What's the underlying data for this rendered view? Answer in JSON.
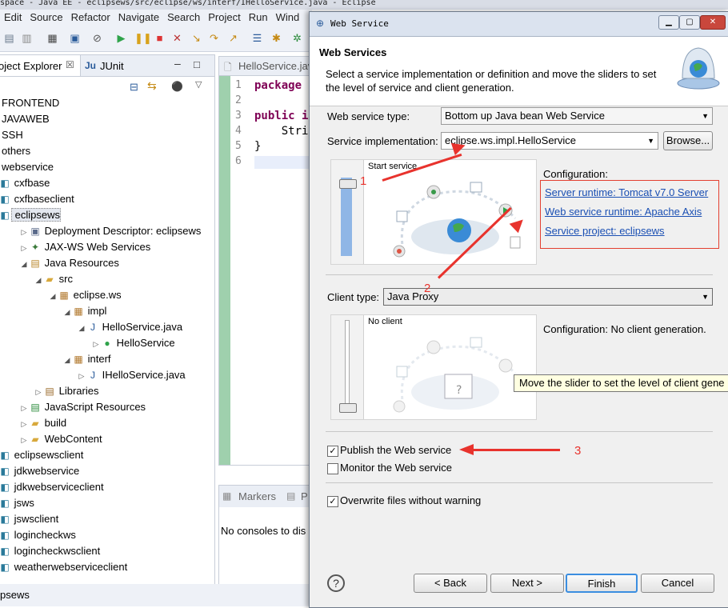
{
  "eclipse": {
    "title": "space - Java EE - eclipsews/src/eclipse/ws/interf/IHelloService.java - Eclipse",
    "menu": [
      "Edit",
      "Source",
      "Refactor",
      "Navigate",
      "Search",
      "Project",
      "Run",
      "Wind"
    ],
    "panels": {
      "project_explorer": "oject Explorer",
      "junit": "JUnit"
    },
    "editor": {
      "tab": "HelloService.java",
      "lines": [
        {
          "n": "1",
          "code": "package"
        },
        {
          "n": "2",
          "code": ""
        },
        {
          "n": "3",
          "code": "public i"
        },
        {
          "n": "4",
          "code": "    Stri"
        },
        {
          "n": "5",
          "code": "}"
        },
        {
          "n": "6",
          "code": ""
        }
      ]
    },
    "console": {
      "tab_markers": "Markers",
      "tab_p": "P",
      "message": "No consoles to dis"
    },
    "status": "psews",
    "tree": [
      {
        "label": "FRONTEND",
        "depth": 0,
        "icon": "none",
        "twisty": ""
      },
      {
        "label": "JAVAWEB",
        "depth": 0,
        "icon": "none",
        "twisty": ""
      },
      {
        "label": "SSH",
        "depth": 0,
        "icon": "none",
        "twisty": ""
      },
      {
        "label": "others",
        "depth": 0,
        "icon": "none",
        "twisty": ""
      },
      {
        "label": "webservice",
        "depth": 0,
        "icon": "none",
        "twisty": ""
      },
      {
        "label": "cxfbase",
        "depth": 0,
        "icon": "project",
        "twisty": ""
      },
      {
        "label": "cxfbaseclient",
        "depth": 0,
        "icon": "project",
        "twisty": ""
      },
      {
        "label": "eclipsews",
        "depth": 0,
        "icon": "project",
        "twisty": "",
        "selected": true
      },
      {
        "label": "Deployment Descriptor: eclipsews",
        "depth": 1,
        "icon": "descriptor",
        "twisty": "▷"
      },
      {
        "label": "JAX-WS Web Services",
        "depth": 1,
        "icon": "jaxws",
        "twisty": "▷"
      },
      {
        "label": "Java Resources",
        "depth": 1,
        "icon": "resources",
        "twisty": "◢"
      },
      {
        "label": "src",
        "depth": 2,
        "icon": "folder",
        "twisty": "◢"
      },
      {
        "label": "eclipse.ws",
        "depth": 3,
        "icon": "package",
        "twisty": "◢"
      },
      {
        "label": "impl",
        "depth": 4,
        "icon": "package",
        "twisty": "◢"
      },
      {
        "label": "HelloService.java",
        "depth": 5,
        "icon": "javafile",
        "twisty": "◢"
      },
      {
        "label": "HelloService",
        "depth": 6,
        "icon": "class",
        "twisty": "▷"
      },
      {
        "label": "interf",
        "depth": 4,
        "icon": "package",
        "twisty": "◢"
      },
      {
        "label": "IHelloService.java",
        "depth": 5,
        "icon": "javafile",
        "twisty": "▷"
      },
      {
        "label": "Libraries",
        "depth": 2,
        "icon": "library",
        "twisty": "▷"
      },
      {
        "label": "JavaScript Resources",
        "depth": 1,
        "icon": "js",
        "twisty": "▷"
      },
      {
        "label": "build",
        "depth": 1,
        "icon": "folder",
        "twisty": "▷"
      },
      {
        "label": "WebContent",
        "depth": 1,
        "icon": "folder",
        "twisty": "▷"
      },
      {
        "label": "eclipsewsclient",
        "depth": 0,
        "icon": "project",
        "twisty": ""
      },
      {
        "label": "jdkwebservice",
        "depth": 0,
        "icon": "project",
        "twisty": ""
      },
      {
        "label": "jdkwebserviceclient",
        "depth": 0,
        "icon": "project",
        "twisty": ""
      },
      {
        "label": "jsws",
        "depth": 0,
        "icon": "project",
        "twisty": ""
      },
      {
        "label": "jswsclient",
        "depth": 0,
        "icon": "project",
        "twisty": ""
      },
      {
        "label": "logincheckws",
        "depth": 0,
        "icon": "project",
        "twisty": ""
      },
      {
        "label": "logincheckwsclient",
        "depth": 0,
        "icon": "project",
        "twisty": ""
      },
      {
        "label": "weatherwebserviceclient",
        "depth": 0,
        "icon": "project",
        "twisty": ""
      }
    ]
  },
  "dialog": {
    "window_title": "Web Service",
    "heading": "Web Services",
    "description": "Select a service implementation or definition and move the sliders to set the level of service and client generation.",
    "service_type_label": "Web service type:",
    "service_type_value": "Bottom up Java bean Web Service",
    "impl_label": "Service implementation:",
    "impl_value": "eclipse.ws.impl.HelloService",
    "browse": "Browse...",
    "service_level": "Start service",
    "configuration_label": "Configuration:",
    "config_links": [
      "Server runtime: Tomcat v7.0 Server",
      "Web service runtime: Apache Axis",
      "Service project: eclipsews"
    ],
    "client_type_label": "Client type:",
    "client_type_value": "Java Proxy",
    "client_level": "No client",
    "client_configuration": "Configuration: No client generation.",
    "tooltip": "Move the slider to set the level of client gene",
    "publish": "Publish the Web service",
    "monitor": "Monitor the Web service",
    "overwrite": "Overwrite files without warning",
    "checks": {
      "publish": true,
      "monitor": false,
      "overwrite": true
    },
    "buttons": {
      "back": "< Back",
      "next": "Next >",
      "finish": "Finish",
      "cancel": "Cancel"
    },
    "help_glyph": "?"
  },
  "annotations": [
    "1",
    "2",
    "3"
  ]
}
